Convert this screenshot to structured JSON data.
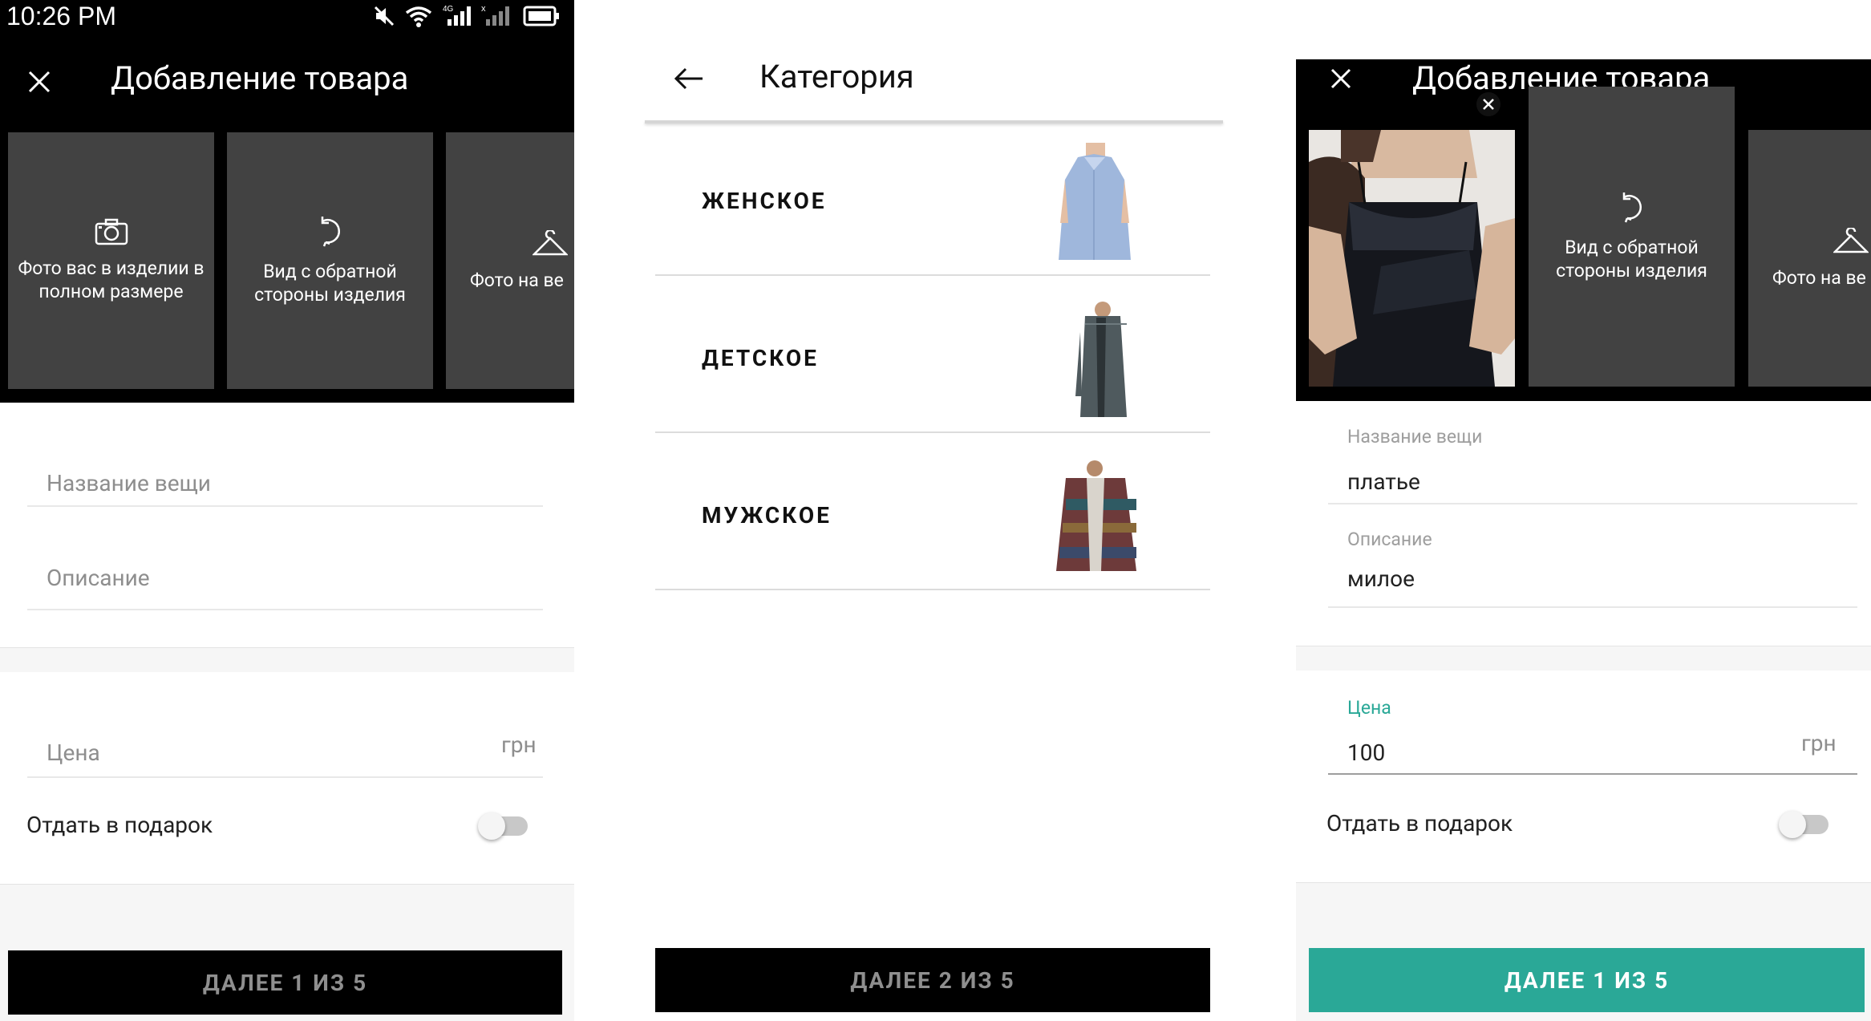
{
  "status_bar": {
    "time": "10:26 PM"
  },
  "screen1": {
    "title": "Добавление товара",
    "tiles": [
      {
        "label": "Фото вас в изделии в полном размере",
        "icon": "camera-icon"
      },
      {
        "label": "Вид с обратной стороны изделия",
        "icon": "rotate-icon"
      },
      {
        "label": "Фото на ве",
        "icon": "hanger-icon"
      }
    ],
    "name_placeholder": "Название вещи",
    "description_placeholder": "Описание",
    "price_placeholder": "Цена",
    "currency": "грн",
    "gift_label": "Отдать в подарок",
    "gift_on": false,
    "next_button": "ДАЛЕЕ 1 ИЗ 5"
  },
  "screen2": {
    "title": "Категория",
    "categories": [
      {
        "label": "ЖЕНСКОЕ",
        "icon": "womens-shirt-photo"
      },
      {
        "label": "ДЕТСКОЕ",
        "icon": "kids-cardigan-photo"
      },
      {
        "label": "МУЖСКОЕ",
        "icon": "mens-jacket-photo"
      }
    ],
    "next_button": "ДАЛЕЕ 2 ИЗ 5"
  },
  "screen3": {
    "title": "Добавление товара",
    "tiles": [
      {
        "label": "",
        "icon": "dress-photo"
      },
      {
        "label": "Вид с обратной стороны изделия",
        "icon": "rotate-icon"
      },
      {
        "label": "Фото на ве",
        "icon": "hanger-icon"
      }
    ],
    "name_label": "Название вещи",
    "name_value": "платье",
    "description_label": "Описание",
    "description_value": "милое",
    "price_label": "Цена",
    "price_value": "100",
    "currency": "грн",
    "gift_label": "Отдать в подарок",
    "gift_on": false,
    "next_button": "ДАЛЕЕ 1 ИЗ 5"
  },
  "colors": {
    "accent": "#2aa897",
    "toolbar": "#000000",
    "tile": "#424242",
    "button_text_disabled": "#8f8f8f"
  }
}
